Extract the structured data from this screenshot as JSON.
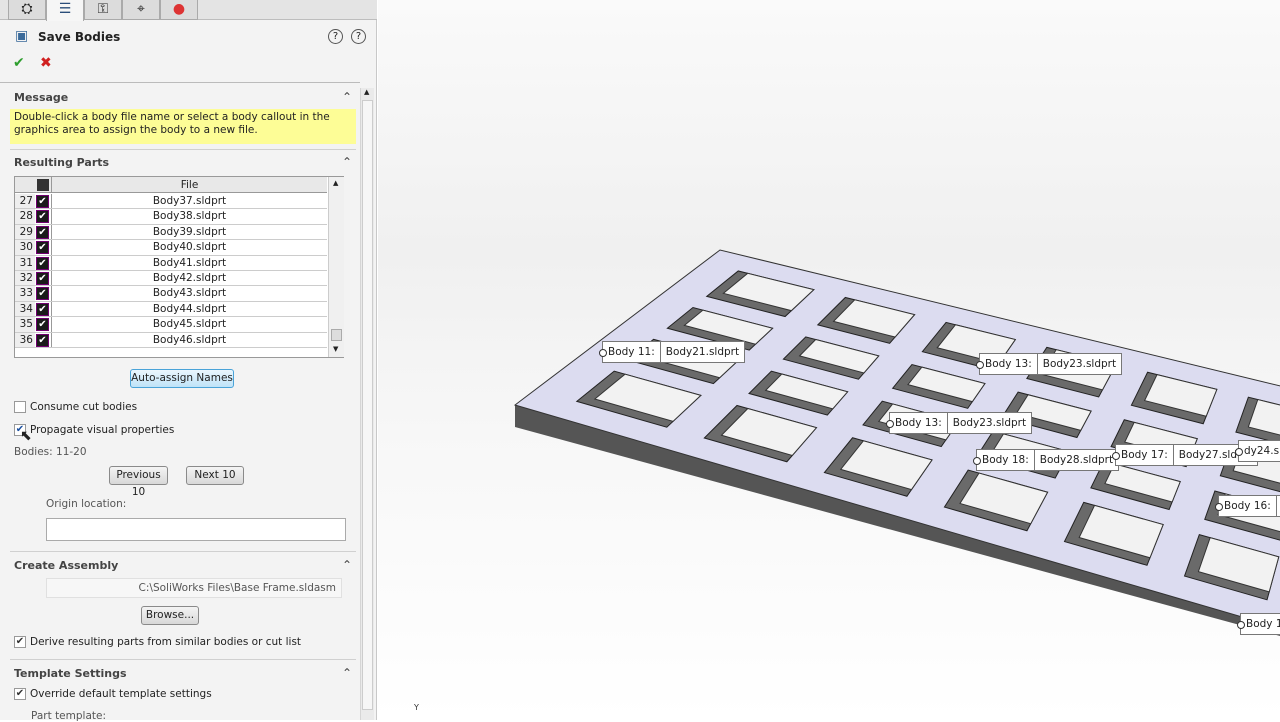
{
  "tabs": [
    {
      "icon": "feature-manager-icon"
    },
    {
      "icon": "property-manager-icon",
      "active": true
    },
    {
      "icon": "configuration-manager-icon"
    },
    {
      "icon": "dimxpert-icon"
    },
    {
      "icon": "display-manager-icon"
    }
  ],
  "title": "Save Bodies",
  "message": {
    "header": "Message",
    "text": "Double-click a body file name or select a body callout in the graphics area to assign the body to a new file."
  },
  "resulting_parts": {
    "header": "Resulting Parts",
    "column": "File",
    "rows": [
      {
        "n": "27",
        "file": "Body37.sldprt",
        "checked": true
      },
      {
        "n": "28",
        "file": "Body38.sldprt",
        "checked": true
      },
      {
        "n": "29",
        "file": "Body39.sldprt",
        "checked": true
      },
      {
        "n": "30",
        "file": "Body40.sldprt",
        "checked": true
      },
      {
        "n": "31",
        "file": "Body41.sldprt",
        "checked": true
      },
      {
        "n": "32",
        "file": "Body42.sldprt",
        "checked": true
      },
      {
        "n": "33",
        "file": "Body43.sldprt",
        "checked": true
      },
      {
        "n": "34",
        "file": "Body44.sldprt",
        "checked": true
      },
      {
        "n": "35",
        "file": "Body45.sldprt",
        "checked": true
      },
      {
        "n": "36",
        "file": "Body46.sldprt",
        "checked": true
      }
    ]
  },
  "auto_assign": "Auto-assign Names",
  "consume_cut": {
    "label": "Consume cut bodies",
    "checked": false
  },
  "propagate": {
    "label": "Propagate visual properties",
    "checked": true
  },
  "bodies_range": "Bodies: 11-20",
  "prev": "Previous 10",
  "next": "Next 10",
  "origin_label": "Origin location:",
  "origin_value": "",
  "assembly": {
    "header": "Create Assembly",
    "path": "C:\\SoliWorks Files\\Base Frame.sldasm",
    "browse": "Browse...",
    "derive": {
      "label": "Derive resulting parts from similar bodies or cut list",
      "checked": true
    }
  },
  "template": {
    "header": "Template Settings",
    "override": {
      "label": "Override default template settings",
      "checked": true
    },
    "part_template": "Part template:"
  },
  "callouts": [
    {
      "label": "Body 11:",
      "file": "Body21.sldprt"
    },
    {
      "label": "Body 13:",
      "file": "Body23.sldprt"
    },
    {
      "label": "Body 13:",
      "file": "Body23.sldprt"
    },
    {
      "label": "Body 18:",
      "file": "Body28.sldprt"
    },
    {
      "label": "Body 17:",
      "file": "Body27.sldprt"
    },
    {
      "label": "",
      "file": "dy24.sl"
    },
    {
      "label": "Body 16:",
      "file": "B"
    },
    {
      "label": "Body 1",
      "file": ""
    }
  ],
  "axis_label": "Y",
  "colors": {
    "message_bg": "#fdfd96",
    "accent": "#7ec8e3",
    "check_ok": "#2e9e2e",
    "cancel": "#d02020"
  }
}
